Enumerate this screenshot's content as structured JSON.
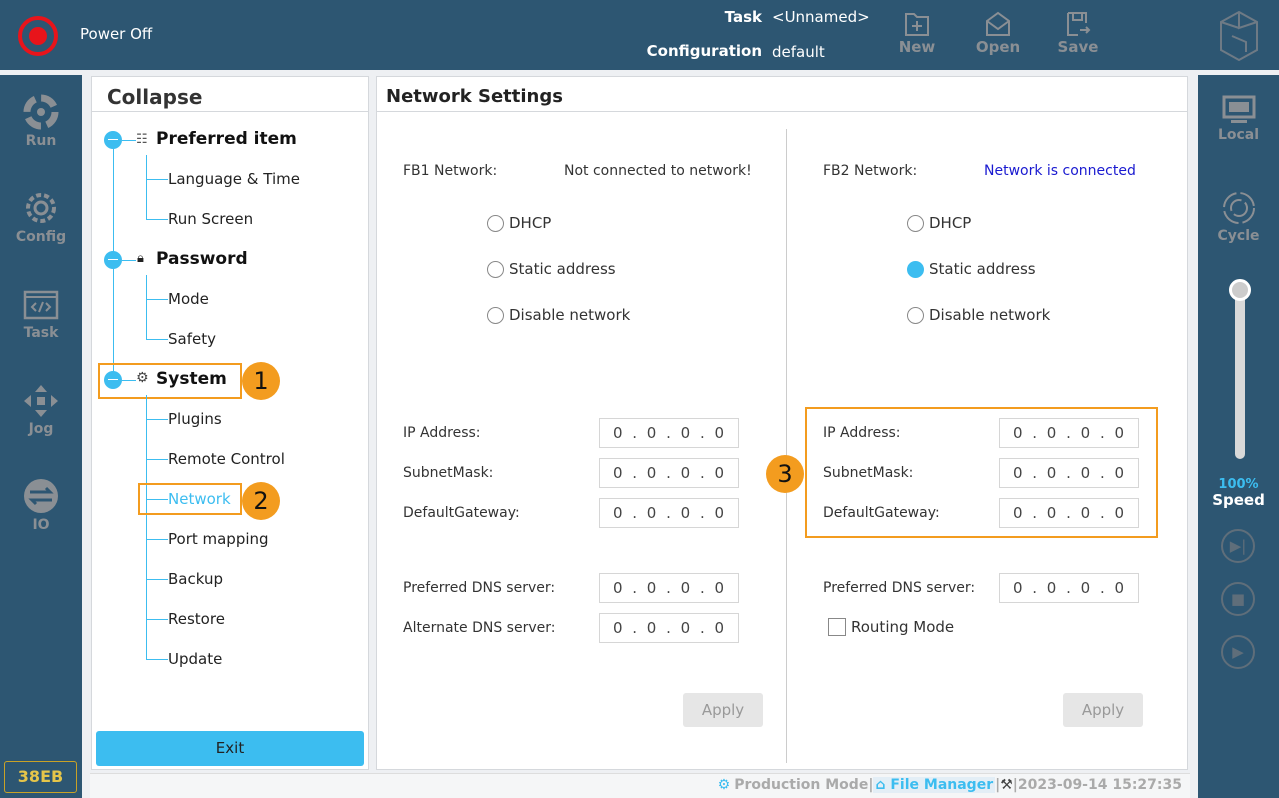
{
  "header": {
    "power_status": "Power Off",
    "task_label": "Task",
    "task_value": "<Unnamed>",
    "config_label": "Configuration",
    "config_value": "default",
    "new_label": "New",
    "open_label": "Open",
    "save_label": "Save"
  },
  "leftnav": [
    {
      "label": "Run",
      "icon": "run-icon"
    },
    {
      "label": "Config",
      "icon": "gear-icon"
    },
    {
      "label": "Task",
      "icon": "code-icon"
    },
    {
      "label": "Jog",
      "icon": "move-arrows-icon"
    },
    {
      "label": "IO",
      "icon": "io-icon"
    }
  ],
  "device_id": "38EB",
  "sidebar": {
    "title": "Collapse",
    "groups": [
      {
        "label": "Preferred item",
        "icon": "list-icon",
        "items": [
          "Language & Time",
          "Run Screen"
        ]
      },
      {
        "label": "Password",
        "icon": "lock-icon",
        "items": [
          "Mode",
          "Safety"
        ]
      },
      {
        "label": "System",
        "icon": "gear-icon",
        "items": [
          "Plugins",
          "Remote Control",
          "Network",
          "Port mapping",
          "Backup",
          "Restore",
          "Update"
        ]
      }
    ],
    "selected": "Network",
    "exit_label": "Exit"
  },
  "annotations": [
    "1",
    "2",
    "3"
  ],
  "main": {
    "title": "Network Settings",
    "fb1": {
      "label": "FB1 Network:",
      "status": "Not connected to network!",
      "options": [
        "DHCP",
        "Static address",
        "Disable network"
      ],
      "selected": null,
      "fields": [
        {
          "label": "IP Address:",
          "value": "0 . 0 . 0 . 0"
        },
        {
          "label": "SubnetMask:",
          "value": "0 . 0 . 0 . 0"
        },
        {
          "label": "DefaultGateway:",
          "value": "0 . 0 . 0 . 0"
        },
        {
          "label": "Preferred DNS server:",
          "value": "0 . 0 . 0 . 0"
        },
        {
          "label": "Alternate DNS server:",
          "value": "0 . 0 . 0 . 0"
        }
      ],
      "apply_label": "Apply"
    },
    "fb2": {
      "label": "FB2 Network:",
      "status": "Network is connected",
      "options": [
        "DHCP",
        "Static address",
        "Disable network"
      ],
      "selected": "Static address",
      "fields": [
        {
          "label": "IP Address:",
          "value": "0 . 0 . 0 . 0"
        },
        {
          "label": "SubnetMask:",
          "value": "0 . 0 . 0 . 0"
        },
        {
          "label": "DefaultGateway:",
          "value": "0 . 0 . 0 . 0"
        },
        {
          "label": "Preferred DNS server:",
          "value": "0 . 0 . 0 . 0"
        }
      ],
      "routing_label": "Routing Mode",
      "routing_checked": false,
      "apply_label": "Apply"
    }
  },
  "rightrail": {
    "local_label": "Local",
    "cycle_label": "Cycle",
    "speed_value": "100%",
    "speed_percent": 100,
    "speed_label": "Speed"
  },
  "statusbar": {
    "mode": "Production Mode",
    "file_manager": "File Manager",
    "datetime": "2023-09-14 15:27:35"
  },
  "colors": {
    "header_bg": "#2d5672",
    "accent": "#3cbdf0",
    "highlight": "#f39c1f",
    "power": "#e8141b",
    "connected": "#1a1ad0"
  }
}
